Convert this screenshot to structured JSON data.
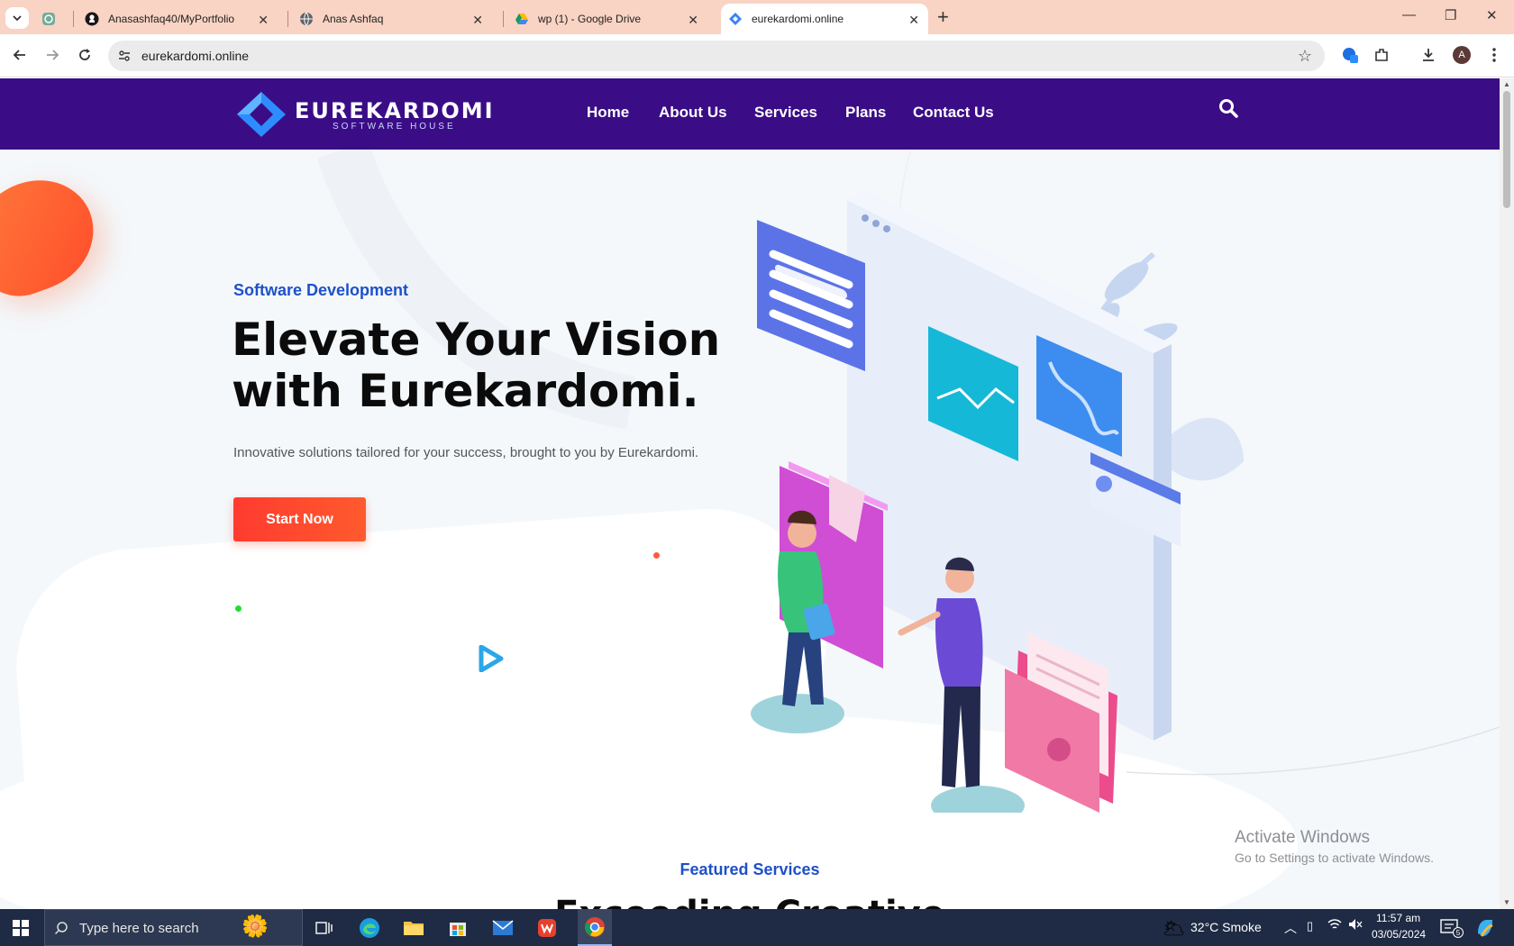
{
  "browser": {
    "tabs": [
      {
        "title": "",
        "icon": "chatgpt-icon"
      },
      {
        "title": "Anasashfaq40/MyPortfolio",
        "icon": "github-icon"
      },
      {
        "title": "Anas Ashfaq",
        "icon": "globe-icon"
      },
      {
        "title": "wp (1) - Google Drive",
        "icon": "google-drive-icon"
      },
      {
        "title": "eurekardomi.online",
        "icon": "site-logo-icon",
        "active": true
      }
    ],
    "url": "eurekardomi.online",
    "profile_initial": "A"
  },
  "site": {
    "logo": {
      "name": "EUREKARDOMI",
      "tagline": "SOFTWARE HOUSE"
    },
    "menu": [
      "Home",
      "About Us",
      "Services",
      "Plans",
      "Contact Us"
    ],
    "hero": {
      "eyebrow": "Software Development",
      "headline_line1": "Elevate Your Vision",
      "headline_line2": "with Eurekardomi.",
      "subtext": "Innovative solutions tailored for your success, brought to you by Eurekardomi.",
      "cta": "Start Now"
    },
    "featured": {
      "eyebrow": "Featured Services",
      "heading": "Exceeding Creative"
    }
  },
  "watermark": {
    "line1": "Activate Windows",
    "line2": "Go to Settings to activate Windows."
  },
  "taskbar": {
    "search_placeholder": "Type here to search",
    "weather": "32°C  Smoke",
    "time": "11:57 am",
    "date": "03/05/2024",
    "notifications": "5"
  },
  "colors": {
    "nav": "#3a0d86",
    "accent": "#1e50c8",
    "cta": "#ff4a2e",
    "tabstrip": "#f9d3c3"
  }
}
